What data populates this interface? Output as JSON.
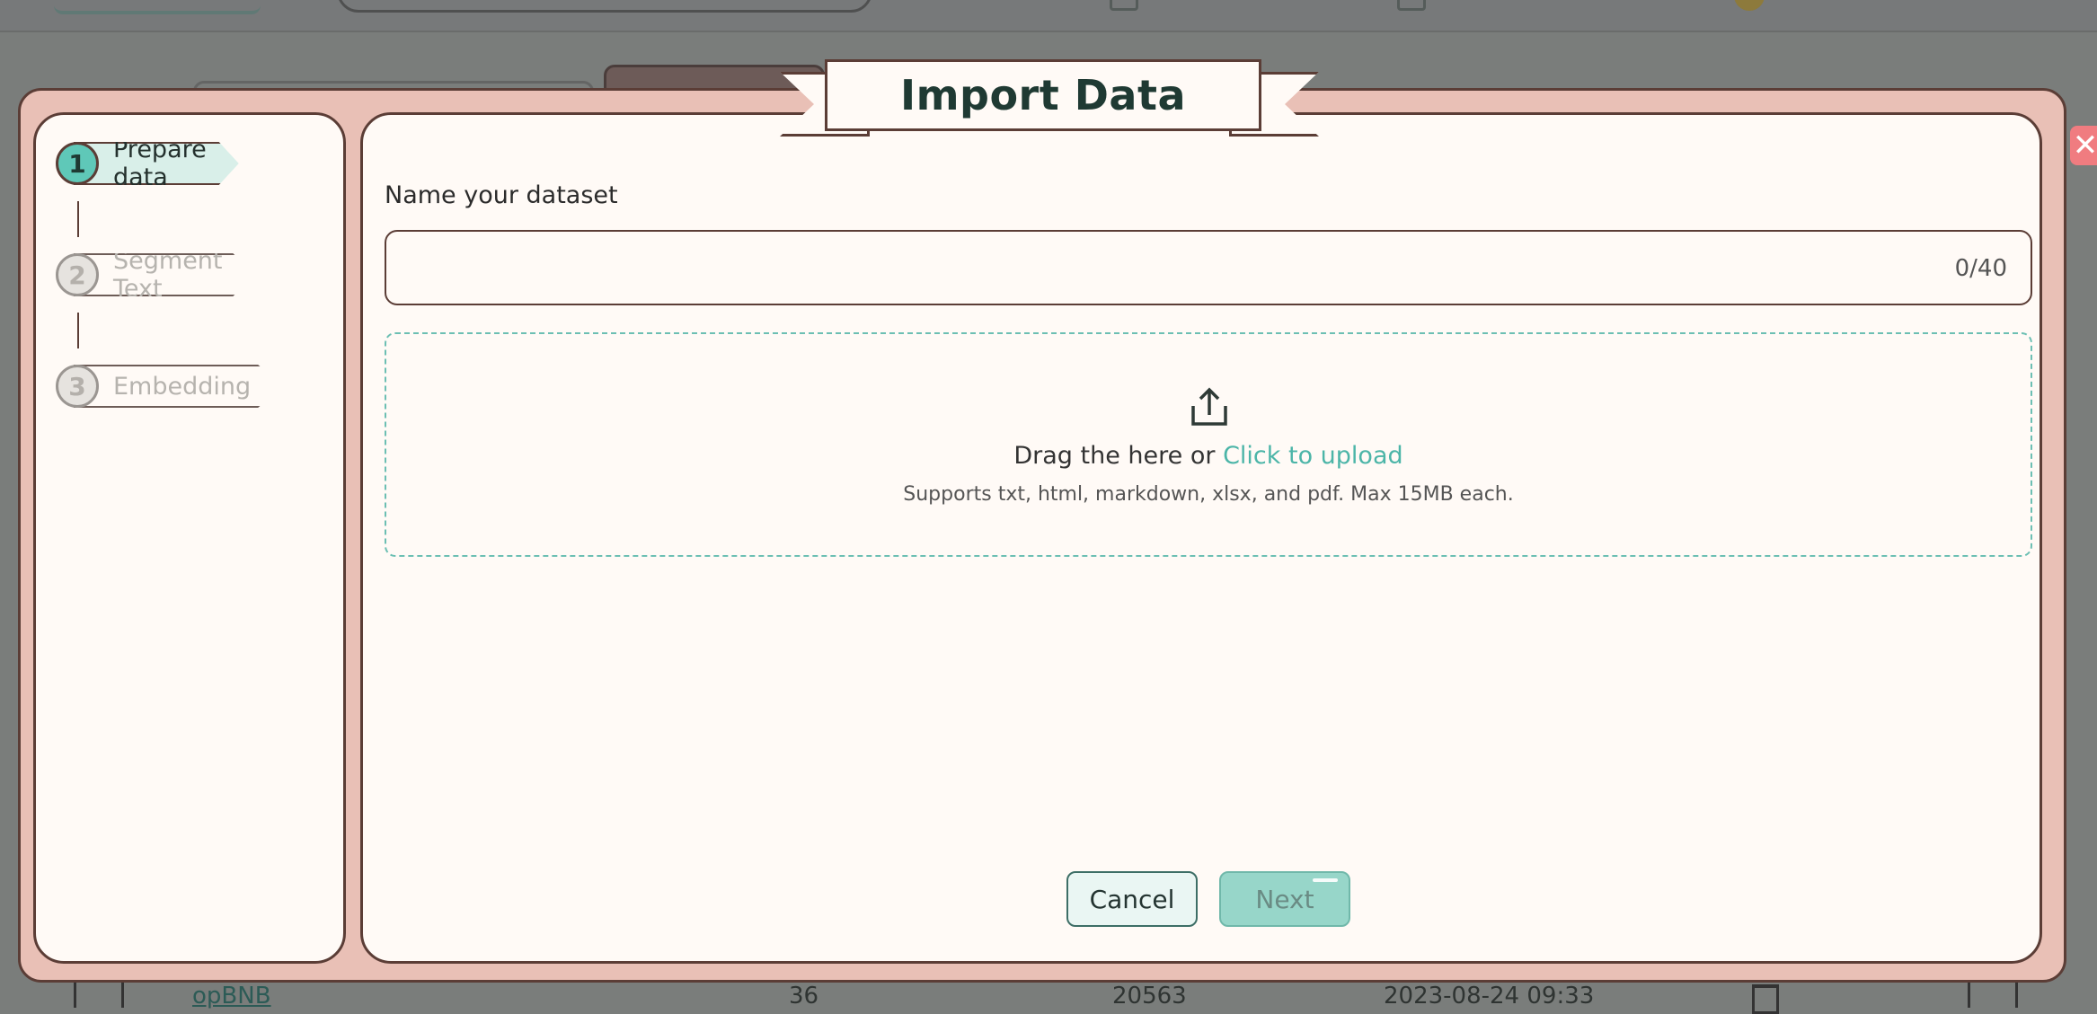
{
  "background": {
    "table_row": {
      "name": "opBNB",
      "count": "36",
      "size": "20563",
      "time": "2023-08-24 09:33"
    }
  },
  "modal": {
    "title": "Import Data",
    "close_label": "✕",
    "steps": [
      {
        "number": "1",
        "label": "Prepare data",
        "state": "active"
      },
      {
        "number": "2",
        "label": "Segment Text",
        "state": "inactive"
      },
      {
        "number": "3",
        "label": "Embedding",
        "state": "inactive"
      }
    ],
    "dataset_name": {
      "label": "Name your dataset",
      "value": "",
      "placeholder": "",
      "counter": "0/40"
    },
    "upload": {
      "icon": "upload-icon",
      "prompt": "Drag the here or ",
      "link": "Click to upload",
      "hint": "Supports txt, html, markdown, xlsx, and pdf. Max 15MB each."
    },
    "buttons": {
      "cancel": "Cancel",
      "next": "Next"
    }
  },
  "colors": {
    "frame": "#e9c0b6",
    "panel": "#fffaf6",
    "border": "#5b3d36",
    "accent": "#5fc8b8",
    "link": "#4cb5a8",
    "close": "#f07c80"
  }
}
